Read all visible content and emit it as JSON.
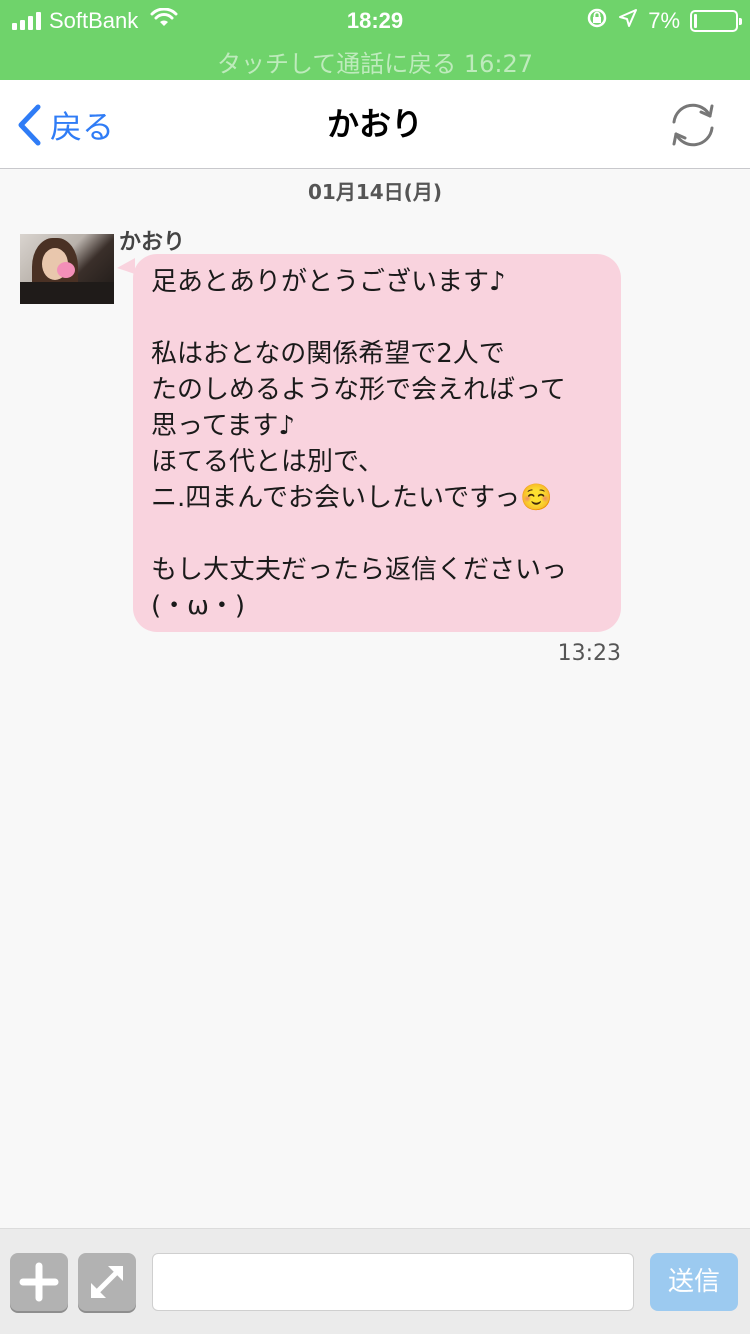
{
  "status_bar": {
    "carrier": "SoftBank",
    "time": "18:29",
    "battery_percent": "7%",
    "battery_level": 0.07,
    "call_banner": "タッチして通話に戻る 16:27",
    "background_color": "#6fd36b"
  },
  "nav": {
    "back_label": "戻る",
    "title": "かおり",
    "accent_color": "#2f7cf6"
  },
  "chat": {
    "date": "01月14日(月)",
    "messages": [
      {
        "sender": "かおり",
        "text": "足あとありがとうございます♪\n\n私はおとなの関係希望で2人で\nたのしめるような形で会えればって\n思ってます♪\nほてる代とは別で、\nニ.四まんでお会いしたいですっ☺️\n\nもし大丈夫だったら返信くださいっ\n(・ω・)",
        "time": "13:23",
        "bubble_color": "#f9d3de"
      }
    ]
  },
  "input_bar": {
    "message_value": "",
    "send_label": "送信",
    "send_color": "#9ccaf0"
  }
}
